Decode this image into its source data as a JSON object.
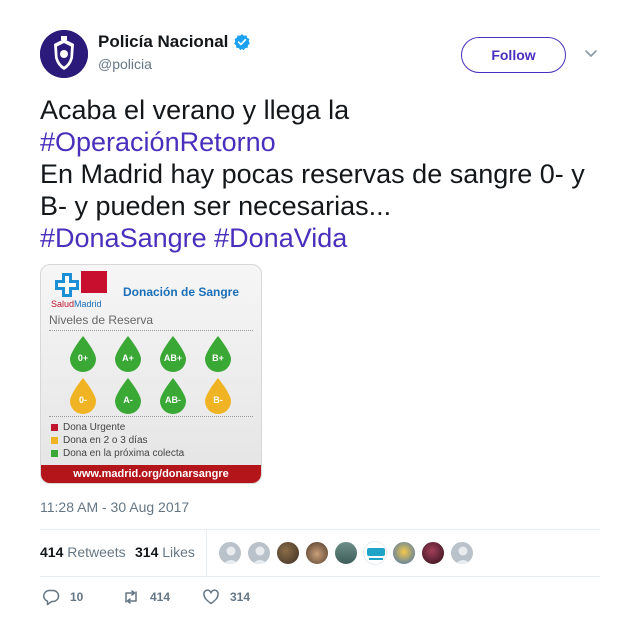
{
  "author": {
    "name": "Policía Nacional",
    "handle": "@policia",
    "verified": true,
    "follow_label": "Follow",
    "avatar_icon": "police-badge-icon"
  },
  "tweet": {
    "line1": "Acaba el verano y llega la",
    "hashtag1": "#OperaciónRetorno",
    "line2": "En Madrid hay pocas reservas de sangre 0- y B- y pueden ser necesarias...",
    "hashtag2": "#DonaSangre",
    "hashtag3": "#DonaVida"
  },
  "card": {
    "brand_salud": "Salud",
    "brand_madrid": "Madrid",
    "title": "Donación de Sangre",
    "levels_title": "Niveles de Reserva",
    "drops": [
      {
        "label": "0+",
        "color": "#3aa835"
      },
      {
        "label": "A+",
        "color": "#3aa835"
      },
      {
        "label": "AB+",
        "color": "#3aa835"
      },
      {
        "label": "B+",
        "color": "#3aa835"
      },
      {
        "label": "0-",
        "color": "#f0b323"
      },
      {
        "label": "A-",
        "color": "#3aa835"
      },
      {
        "label": "AB-",
        "color": "#3aa835"
      },
      {
        "label": "B-",
        "color": "#f0b323"
      }
    ],
    "legend": [
      {
        "label": "Dona Urgente",
        "color": "#c0162d"
      },
      {
        "label": "Dona en 2 o 3 días",
        "color": "#f0b323"
      },
      {
        "label": "Dona en la próxima colecta",
        "color": "#3aa835"
      }
    ],
    "url": "www.madrid.org/donarsangre"
  },
  "timestamp": "11:28 AM - 30 Aug 2017",
  "stats": {
    "retweets_count": "414",
    "retweets_label": "Retweets",
    "likes_count": "314",
    "likes_label": "Likes"
  },
  "actions": {
    "replies": "10",
    "retweets": "414",
    "likes": "314"
  },
  "colors": {
    "accent": "#4a2fbd",
    "muted": "#657786",
    "verified": "#1da1f2"
  }
}
